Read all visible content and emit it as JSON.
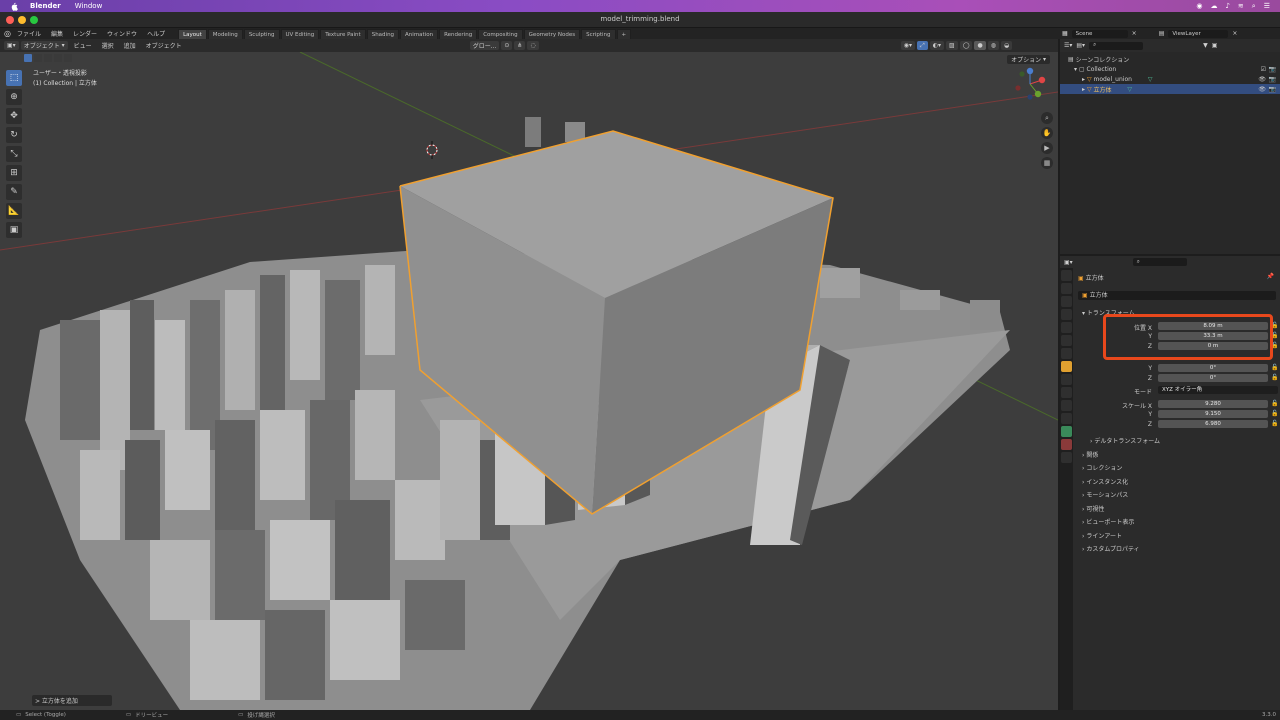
{
  "mac_menu": {
    "app": "Blender",
    "window": "Window"
  },
  "window_title": "model_trimming.blend",
  "menu": [
    "ファイル",
    "編集",
    "レンダー",
    "ウィンドウ",
    "ヘルプ"
  ],
  "workspace_tabs": [
    "Layout",
    "Modeling",
    "Sculpting",
    "UV Editing",
    "Texture Paint",
    "Shading",
    "Animation",
    "Rendering",
    "Compositing",
    "Geometry Nodes",
    "Scripting"
  ],
  "scene_name": "Scene",
  "view_layer": "ViewLayer",
  "viewport_header": {
    "mode": "オブジェクト",
    "menus": [
      "ビュー",
      "選択",
      "追加",
      "オブジェクト"
    ],
    "transform": "グロー..."
  },
  "viewport_info": {
    "line1": "ユーザー・透視投影",
    "line2": "(1) Collection | 立方体"
  },
  "options_label": "オプション",
  "last_operator": "> 立方体を追加",
  "outliner": {
    "root": "シーンコレクション",
    "collection": "Collection",
    "items": [
      "model_union",
      "立方体"
    ]
  },
  "properties": {
    "object_name": "立方体",
    "object_field": "立方体",
    "transform_header": "トランスフォーム",
    "location": {
      "label": "位置 X",
      "x": "8.09 m",
      "y": "33.3 m",
      "z": "0 m"
    },
    "rotation": {
      "y": "0°",
      "z": "0°"
    },
    "mode": {
      "label": "モード",
      "value": "XYZ オイラー角"
    },
    "scale": {
      "label": "スケール X",
      "x": "9.280",
      "y": "9.150",
      "z": "6.980"
    },
    "delta": "デルタトランスフォーム",
    "sections": [
      "関係",
      "コレクション",
      "インスタンス化",
      "モーションパス",
      "可視性",
      "ビューポート表示",
      "ラインアート",
      "カスタムプロパティ"
    ]
  },
  "status": {
    "select": "Select (Toggle)",
    "dolly": "ドリービュー",
    "lasso": "投げ縄選択",
    "version": "3.3.0"
  },
  "colors": {
    "accent": "#4772b3",
    "selection_outline": "#f0a030",
    "highlight": "#e8481c"
  }
}
